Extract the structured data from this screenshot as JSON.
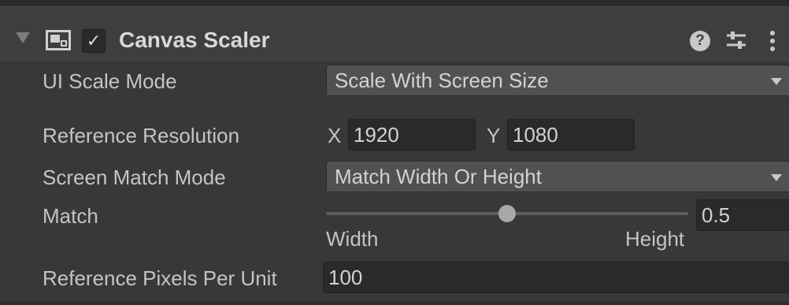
{
  "component": {
    "title": "Canvas Scaler",
    "enabled_glyph": "✓",
    "help_glyph": "?",
    "icons": [
      "foldout-arrow-icon",
      "canvas-scaler-component-icon",
      "help-icon",
      "presets-icon",
      "context-menu-icon"
    ]
  },
  "fields": {
    "ui_scale_mode": {
      "label": "UI Scale Mode",
      "value": "Scale With Screen Size"
    },
    "reference_resolution": {
      "label": "Reference Resolution",
      "x_label": "X",
      "x_value": "1920",
      "y_label": "Y",
      "y_value": "1080"
    },
    "screen_match_mode": {
      "label": "Screen Match Mode",
      "value": "Match Width Or Height"
    },
    "match": {
      "label": "Match",
      "value_text": "0.5",
      "value": 0.5,
      "min_label": "Width",
      "max_label": "Height"
    },
    "reference_pixels_per_unit": {
      "label": "Reference Pixels Per Unit",
      "value": "100"
    }
  },
  "colors": {
    "background": "#383838",
    "header": "#3e3e3e",
    "field_dark": "#2a2a2a",
    "dropdown": "#515151"
  }
}
